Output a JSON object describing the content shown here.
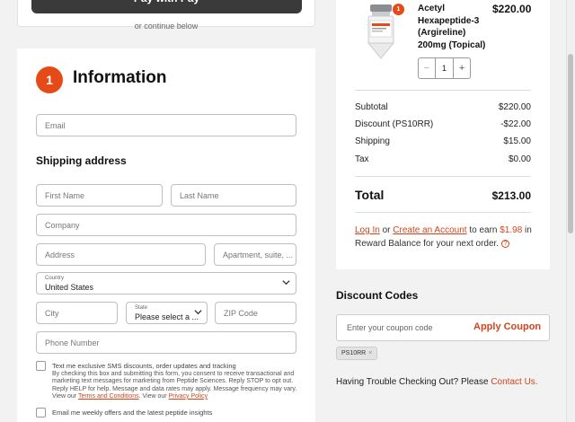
{
  "express": {
    "pay_label": "Pay with  Pay",
    "or_continue": "or continue below"
  },
  "information": {
    "step": "1",
    "title": "Information",
    "email_placeholder": "Email",
    "shipping_title": "Shipping address",
    "first_name": "First Name",
    "last_name": "Last Name",
    "company": "Company",
    "address": "Address",
    "apartment": "Apartment, suite, ...",
    "country_label": "Country",
    "country_value": "United States",
    "city": "City",
    "state_label": "State",
    "state_value": "Please select a ...",
    "zip": "ZIP Code",
    "phone": "Phone Number",
    "sms_label": "Text me exclusive SMS discounts, order updates and tracking",
    "sms_fine_1": "By checking this box and submitting this form, you consent to receive transactional and marketing text messages for marketing from Peptide Sciences. Reply STOP to opt out. Reply HELP for help. Message and data rates may apply. Message frequency may vary. View our ",
    "terms_link": "Terms and Conditions",
    "sms_fine_2": ". View our ",
    "privacy_link": "Privacy Policy",
    "email_offers_label": "Email me weekly offers and the latest peptide insights"
  },
  "cart": {
    "item": {
      "name": "Acetyl Hexapeptide-3 (Argireline) 200mg (Topical)",
      "price": "$220.00",
      "qty_badge": "1",
      "qty": "1",
      "minus": "−",
      "plus": "+"
    },
    "subtotal_label": "Subtotal",
    "subtotal": "$220.00",
    "discount_label": "Discount (PS10RR)",
    "discount": "-$22.00",
    "shipping_label": "Shipping",
    "shipping": "$15.00",
    "tax_label": "Tax",
    "tax": "$0.00",
    "total_label": "Total",
    "total": "$213.00",
    "reward": {
      "login": "Log In",
      "or": " or ",
      "create": "Create an Account",
      "earn": " to earn ",
      "amount": "$1.98",
      "rest": " in Reward Balance for your next order.",
      "icon": "?"
    }
  },
  "discount": {
    "title": "Discount Codes",
    "placeholder": "Enter your coupon code",
    "apply": "Apply Coupon",
    "applied_code": "PS10RR",
    "remove": "×"
  },
  "help": {
    "text": "Having Trouble Checking Out? Please ",
    "link": "Contact Us."
  },
  "colors": {
    "accent": "#e64a19",
    "link": "#d4441c"
  }
}
